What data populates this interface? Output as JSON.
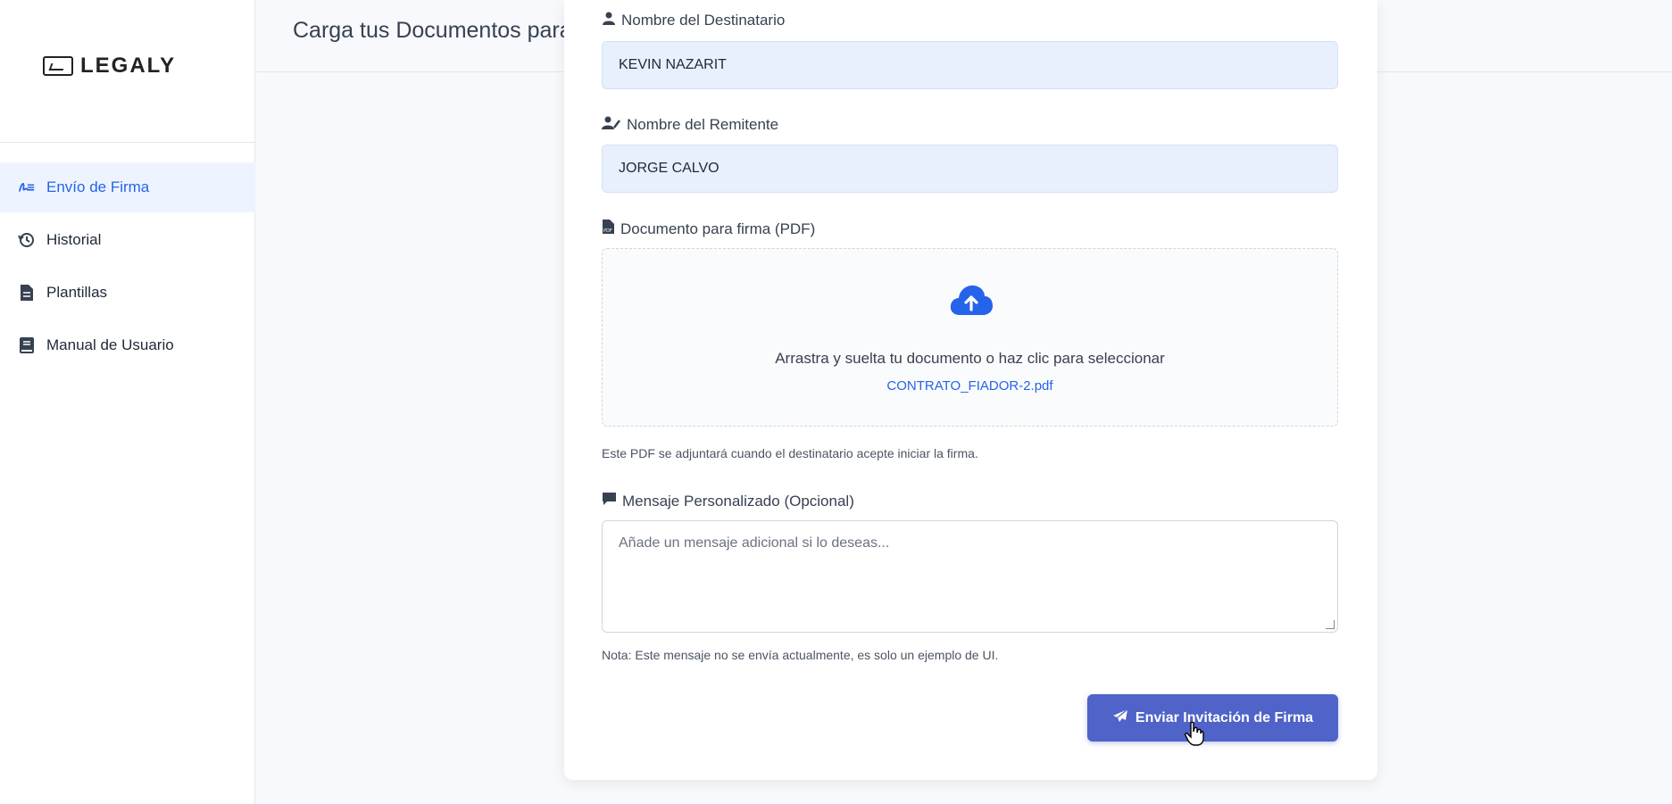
{
  "app": {
    "logo_text": "LEGALY",
    "page_title": "Carga tus Documentos para Firma"
  },
  "sidebar": {
    "items": [
      {
        "label": "Envío de Firma",
        "icon": "signature-icon",
        "active": true
      },
      {
        "label": "Historial",
        "icon": "history-icon",
        "active": false
      },
      {
        "label": "Plantillas",
        "icon": "file-icon",
        "active": false
      },
      {
        "label": "Manual de Usuario",
        "icon": "book-icon",
        "active": false
      }
    ]
  },
  "form": {
    "recipient": {
      "label": "Nombre del Destinatario",
      "value": "KEVIN NAZARIT",
      "icon": "user-icon"
    },
    "sender": {
      "label": "Nombre del Remitente",
      "value": "JORGE CALVO",
      "icon": "user-pen-icon"
    },
    "document": {
      "label": "Documento para firma (PDF)",
      "icon": "pdf-file-icon",
      "drop_text": "Arrastra y suelta tu documento o haz clic para seleccionar",
      "file_name": "CONTRATO_FIADOR-2.pdf",
      "help": "Este PDF se adjuntará cuando el destinatario acepte iniciar la firma."
    },
    "message": {
      "label": "Mensaje Personalizado (Opcional)",
      "icon": "comment-icon",
      "placeholder": "Añade un mensaje adicional si lo deseas...",
      "note": "Nota: Este mensaje no se envía actualmente, es solo un ejemplo de UI."
    },
    "submit_label": "Enviar Invitación de Firma"
  },
  "colors": {
    "accent": "#2563eb",
    "button": "#4f63c8",
    "input_bg": "#e8f0fe"
  }
}
